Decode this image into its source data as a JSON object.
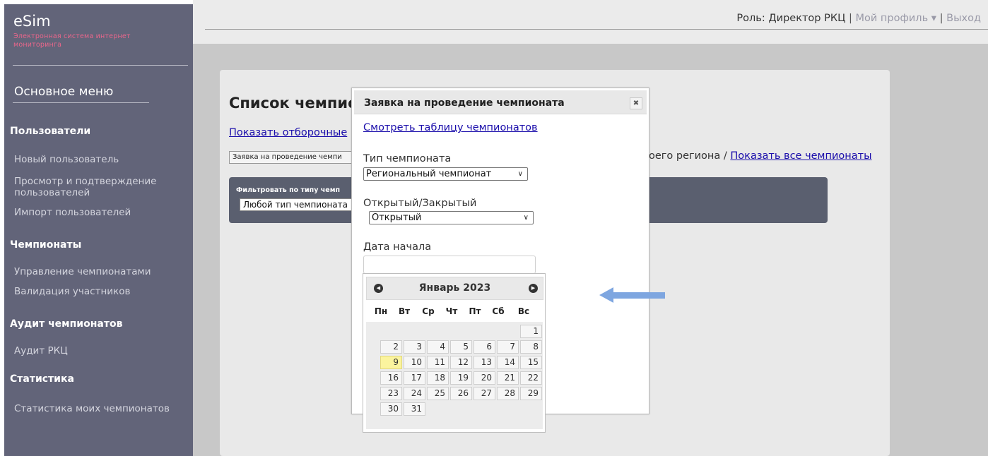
{
  "app": {
    "title": "eSim",
    "subtitle": "Электронная система интернет мониторинга"
  },
  "topbar": {
    "role": "Роль: Директор РКЦ",
    "sep1": "|",
    "profile": "Мой профиль",
    "profile_caret": "▾",
    "sep2": "|",
    "logout": "Выход"
  },
  "sidebar": {
    "menu_title": "Основное меню",
    "sections": [
      {
        "title": "Пользователи",
        "items": [
          "Новый пользователь",
          "Просмотр и подтверждение пользователей",
          "Импорт пользователей"
        ]
      },
      {
        "title": "Чемпионаты",
        "items": [
          "Управление чемпионатами",
          "Валидация участников"
        ]
      },
      {
        "title": "Аудит чемпионатов",
        "items": [
          "Аудит РКЦ"
        ]
      },
      {
        "title": "Статистика",
        "items": [
          "Статистика моих чемпионатов"
        ]
      }
    ]
  },
  "main": {
    "title": "Список чемпио",
    "show_link": "Показать отборочные",
    "request_button": "Заявка на проведение чемпи",
    "region_text": "оего региона",
    "region_sep": "/",
    "show_all_link": "Показать все чемпионаты",
    "filter_label": "Фильтровать по типу чемп",
    "filter_value": "Любой тип чемпионата"
  },
  "dialog": {
    "title": "Заявка на проведение чемпионата",
    "close_glyph": "✖",
    "table_link": "Смотреть таблицу чемпионатов",
    "type_label": "Тип чемпионата",
    "type_value": "Региональный чемпионат",
    "open_label": "Открытый/Закрытый",
    "open_value": "Открытый",
    "date_label": "Дата начала",
    "date_value": ""
  },
  "calendar": {
    "month": "Январь 2023",
    "prev_glyph": "◀",
    "next_glyph": "▶",
    "weekdays": [
      "Пн",
      "Вт",
      "Ср",
      "Чт",
      "Пт",
      "Сб",
      "Вс"
    ],
    "weeks": [
      [
        "",
        "",
        "",
        "",
        "",
        "",
        "1"
      ],
      [
        "2",
        "3",
        "4",
        "5",
        "6",
        "7",
        "8"
      ],
      [
        "9",
        "10",
        "11",
        "12",
        "13",
        "14",
        "15"
      ],
      [
        "16",
        "17",
        "18",
        "19",
        "20",
        "21",
        "22"
      ],
      [
        "23",
        "24",
        "25",
        "26",
        "27",
        "28",
        "29"
      ],
      [
        "30",
        "31",
        "",
        "",
        "",
        "",
        ""
      ]
    ],
    "today": "9"
  },
  "colors": {
    "sidebar": "#626479",
    "subtitle": "#e9668b",
    "link": "#1a0dab",
    "today_highlight": "#fbf49e",
    "arrow": "#7ea6e0"
  }
}
